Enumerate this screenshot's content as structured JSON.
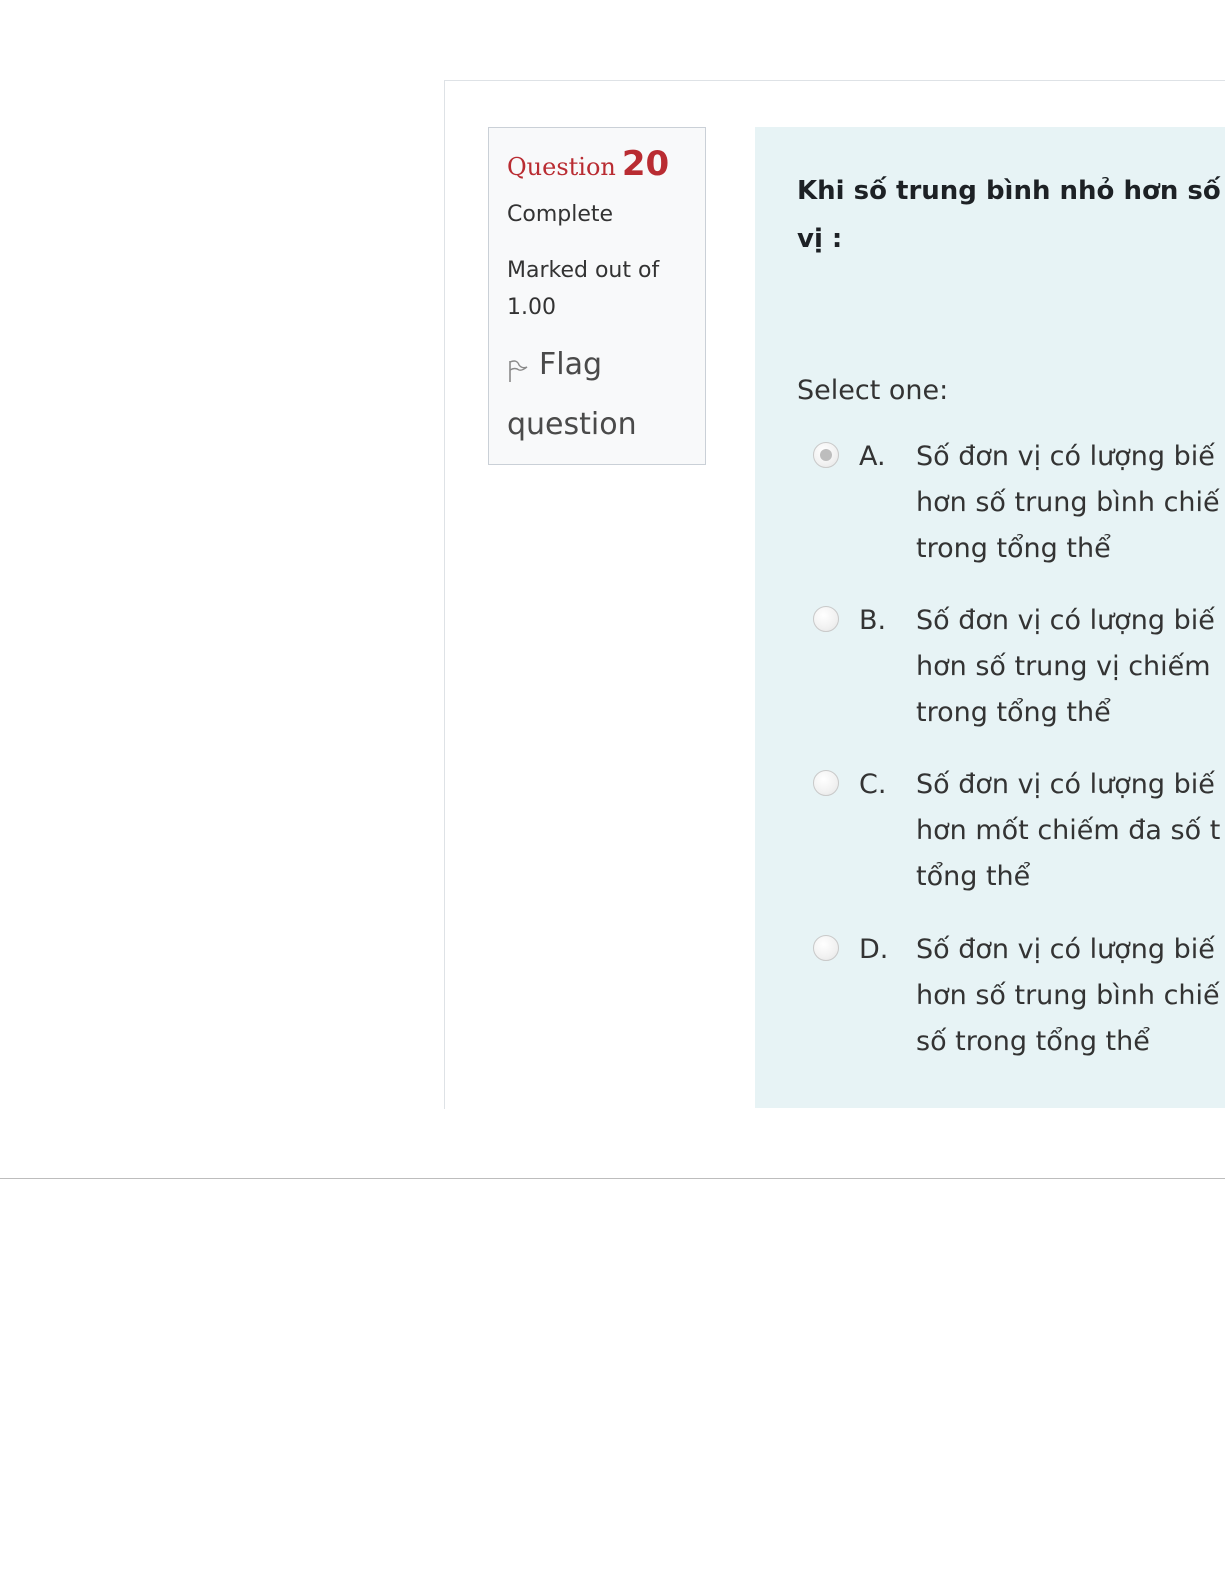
{
  "question": {
    "label": "Question",
    "number": "20",
    "state": "Complete",
    "grade": "Marked out of 1.00",
    "flag": {
      "icon": "flag-icon",
      "label": "Flag question"
    },
    "text": "Khi số trung bình nhỏ hơn số\nvị :",
    "prompt": "Select one:",
    "answers": [
      {
        "letter": "A.",
        "text": "Số đơn vị có lượng biế\nhơn số trung bình chiế\ntrong tổng thể",
        "selected": true
      },
      {
        "letter": "B.",
        "text": "Số đơn vị có lượng biế\nhơn số trung vị chiếm\ntrong tổng thể",
        "selected": false
      },
      {
        "letter": "C.",
        "text": "Số đơn vị có lượng biế\nhơn mốt chiếm đa số t\ntổng thể",
        "selected": false
      },
      {
        "letter": "D.",
        "text": "Số đơn vị có lượng biế\nhơn số trung bình chiế\nsố trong tổng thể",
        "selected": false
      }
    ]
  },
  "colors": {
    "question_label": "#b92c32",
    "info_background": "#f8f9fa",
    "content_background": "#e7f3f5"
  }
}
